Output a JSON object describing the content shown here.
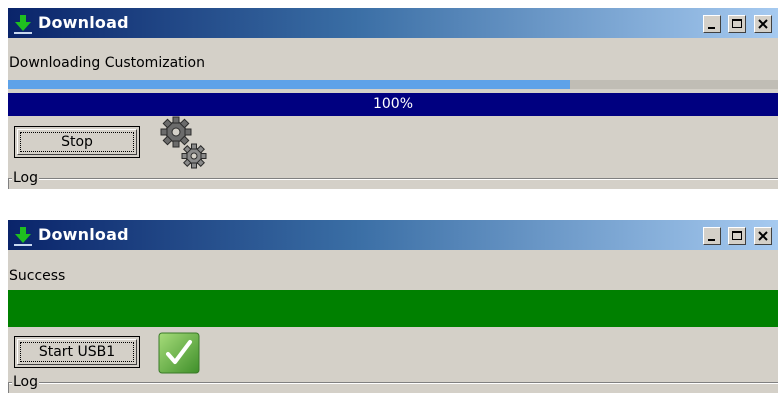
{
  "windows": [
    {
      "title": "Download",
      "status": "Downloading Customization",
      "progress": {
        "fraction": 0.73,
        "label": "100%",
        "fill_color": "#5ea2e8",
        "bar_color": "#000080"
      },
      "button": {
        "label": "Stop"
      },
      "indicator_icon": "gears-icon",
      "log_label": "Log"
    },
    {
      "title": "Download",
      "status": "Success",
      "success_bar_color": "#008000",
      "button": {
        "label": "Start USB1"
      },
      "indicator_icon": "checkmark-icon",
      "log_label": "Log"
    }
  ],
  "window_controls": [
    "minimize-icon",
    "maximize-icon",
    "close-icon"
  ],
  "colors": {
    "titlebar_start": "#0a246a",
    "titlebar_end": "#a6caf0",
    "face": "#d4d0c8"
  }
}
